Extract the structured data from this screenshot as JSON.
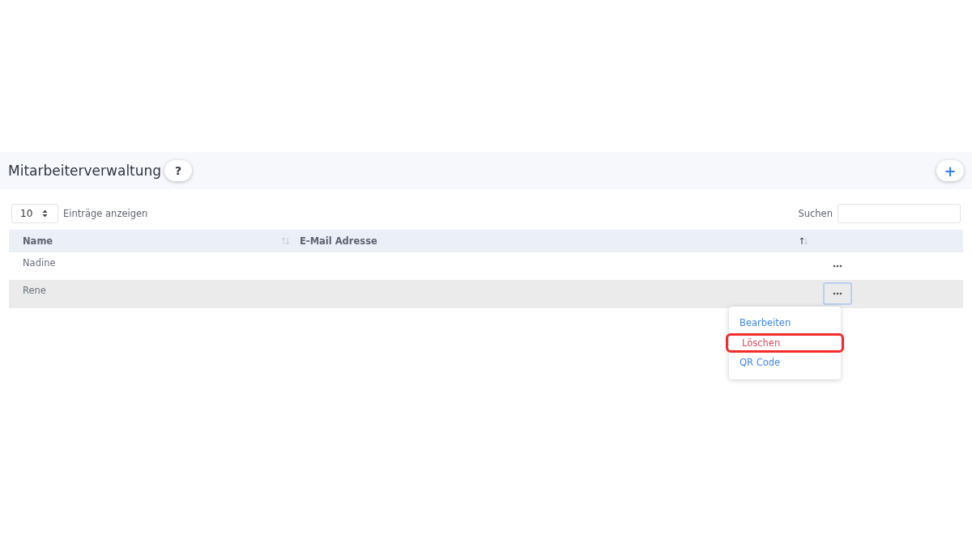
{
  "header": {
    "title": "Mitarbeiterverwaltung",
    "help_label": "?",
    "add_label": "+"
  },
  "controls": {
    "page_size": "10",
    "page_size_label": "Einträge anzeigen",
    "search_label": "Suchen"
  },
  "table": {
    "columns": [
      {
        "label": "Name",
        "sorted_asc": false
      },
      {
        "label": "E-Mail Adresse",
        "sorted_asc": true
      }
    ],
    "rows": [
      {
        "name": "Nadine",
        "selected": false
      },
      {
        "name": "Rene",
        "selected": true
      }
    ]
  },
  "menu": {
    "items": [
      {
        "label": "Bearbeiten",
        "kind": "normal",
        "highlighted": false
      },
      {
        "label": "Löschen",
        "kind": "danger",
        "highlighted": true
      },
      {
        "label": "QR Code",
        "kind": "normal",
        "highlighted": false
      }
    ]
  }
}
